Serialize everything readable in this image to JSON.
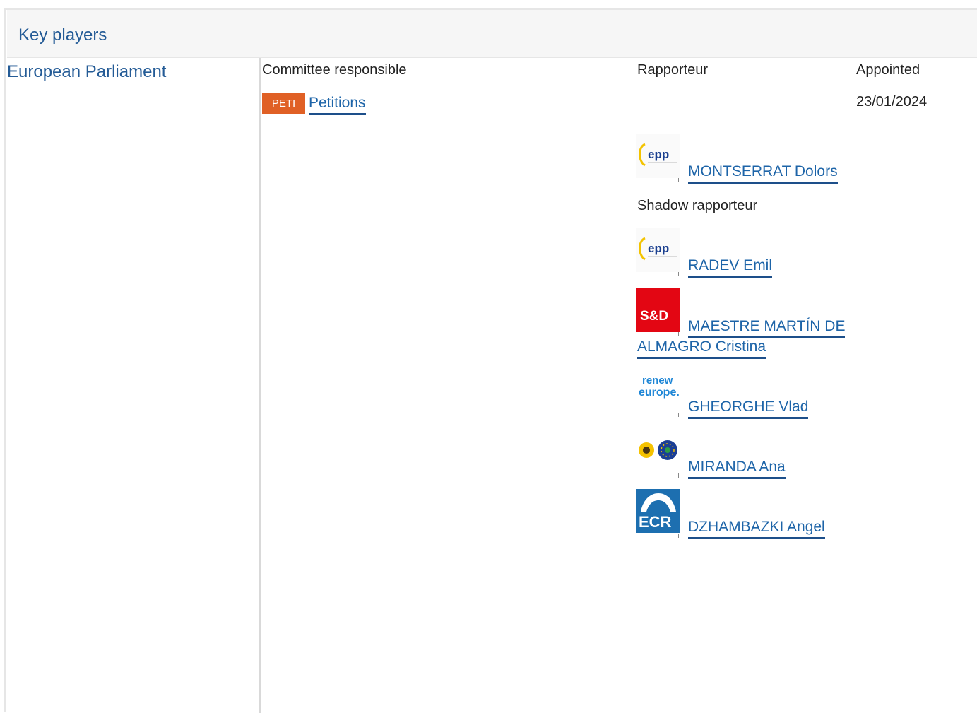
{
  "section": {
    "title": "Key players"
  },
  "institution": {
    "name": "European Parliament"
  },
  "columns": {
    "committee": "Committee responsible",
    "rapporteur": "Rapporteur",
    "appointed": "Appointed"
  },
  "committee": {
    "code": "PETI",
    "name": "Petitions",
    "code_color": "#e06025",
    "appointed": "23/01/2024"
  },
  "rapporteur": {
    "name": "MONTSERRAT Dolors",
    "group_logo": "epp-logo"
  },
  "shadow": {
    "label": "Shadow rapporteur",
    "people": [
      {
        "name": "RADEV Emil",
        "group_logo": "epp-logo"
      },
      {
        "name_line1": "MAESTRE MARTÍN DE",
        "name_line2": "ALMAGRO Cristina",
        "group_logo": "sd-logo",
        "logo_text": "S&D"
      },
      {
        "name": "GHEORGHE Vlad",
        "group_logo": "renew-europe-logo",
        "logo_line1": "renew",
        "logo_line2": "europe."
      },
      {
        "name": "MIRANDA Ana",
        "group_logo": "greens-efa-logo"
      },
      {
        "name": "DZHAMBAZKI Angel",
        "group_logo": "ecr-logo",
        "logo_text": "ECR"
      }
    ]
  },
  "colors": {
    "link": "#1d64a8",
    "heading": "#245b96",
    "sd_red": "#e30613",
    "ecr_blue": "#1d6fb0"
  }
}
